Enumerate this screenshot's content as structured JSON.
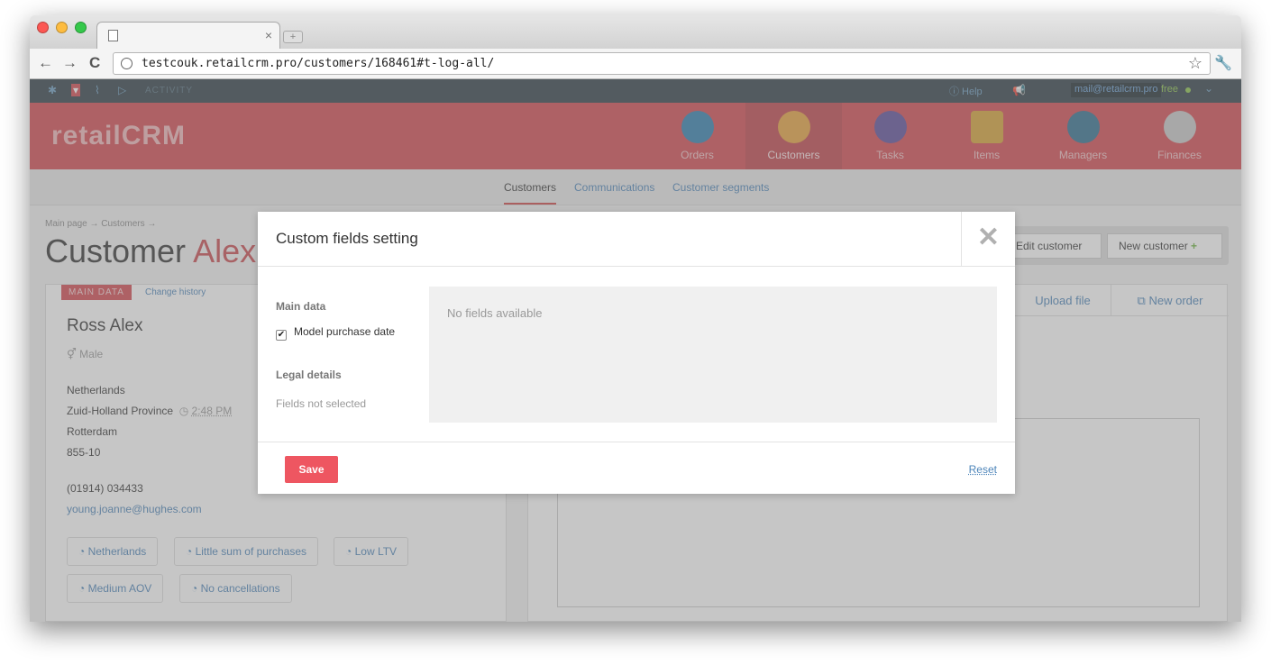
{
  "browser": {
    "tab_close_glyph": "×",
    "newtab_glyph": "+",
    "back_glyph": "←",
    "forward_glyph": "→",
    "reload_glyph": "C",
    "url": "testcouk.retailcrm.pro/customers/168461#t-log-all/",
    "star_glyph": "☆",
    "wrench_glyph": "🔧"
  },
  "topstrip": {
    "activity": "ACTIVITY",
    "help": "ⓘ Help",
    "email": "mail@retailcrm.pro",
    "plan": "free",
    "chevron": "⌄"
  },
  "header": {
    "logo": "retailCRM",
    "nav": [
      {
        "label": "Orders",
        "icon": "cart-icon",
        "color": "#2e7fb0"
      },
      {
        "label": "Customers",
        "icon": "customer-avatar-icon",
        "color": "#e8a23c"
      },
      {
        "label": "Tasks",
        "icon": "tasks-icon",
        "color": "#5b4b9a"
      },
      {
        "label": "Items",
        "icon": "box-icon",
        "color": "#d8a234"
      },
      {
        "label": "Managers",
        "icon": "manager-avatar-icon",
        "color": "#2e6e8e"
      },
      {
        "label": "Finances",
        "icon": "finances-icon",
        "color": "#c9c9c9"
      }
    ]
  },
  "subnav": {
    "customers": "Customers",
    "communications": "Communications",
    "segments": "Customer segments"
  },
  "main": {
    "breadcrumb": "Main page → Customers →",
    "title_prefix": "Customer",
    "title_name": "Alex",
    "edit_customer": "Edit customer",
    "new_customer": "New customer",
    "new_customer_plus": "+"
  },
  "customer": {
    "tag": "MAIN DATA",
    "change_history": "Change history",
    "name": "Ross Alex",
    "gender": "⚥ Male",
    "country": "Netherlands",
    "province": "Zuid-Holland Province",
    "local_time": "2:48 PM",
    "city": "Rotterdam",
    "postal": "855-10",
    "phone": "(01914) 034433",
    "email": "young.joanne@hughes.com",
    "segments": [
      "Netherlands",
      "Little sum of purchases",
      "Low LTV",
      "Medium AOV",
      "No cancellations"
    ]
  },
  "rightpanel": {
    "upload_file": "Upload file",
    "new_order": "New order"
  },
  "modal": {
    "title": "Custom fields setting",
    "close_glyph": "✕",
    "main_data_label": "Main data",
    "checkbox_label": "Model purchase date",
    "checkbox_checked": true,
    "legal_label": "Legal details",
    "fields_not_selected": "Fields not selected",
    "no_fields": "No fields available",
    "save": "Save",
    "reset": "Reset"
  }
}
